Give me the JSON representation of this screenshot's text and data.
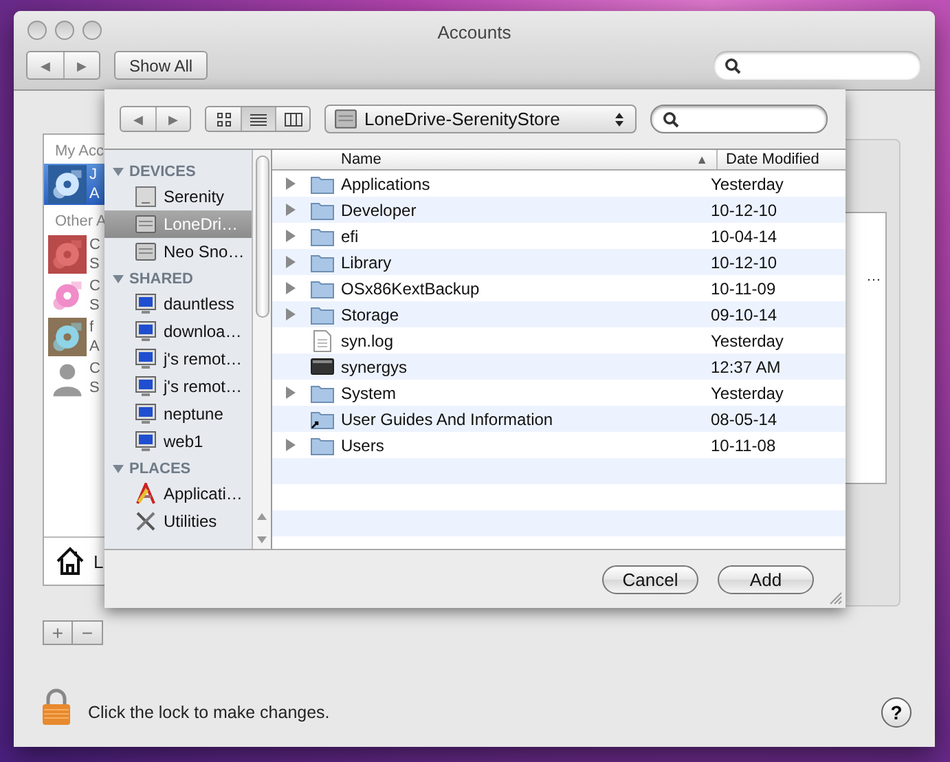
{
  "window": {
    "title": "Accounts"
  },
  "toolbar": {
    "back": "◀",
    "forward": "▶",
    "show_all": "Show All"
  },
  "accounts": {
    "my_header": "My Acc",
    "other_header": "Other A",
    "mine": [
      {
        "line1": "J",
        "line2": "A",
        "kind": "picture",
        "selected": true
      }
    ],
    "others": [
      {
        "line1": "C",
        "line2": "S",
        "kind": "picture",
        "selected": false
      },
      {
        "line1": "C",
        "line2": "S",
        "kind": "picture",
        "selected": false
      },
      {
        "line1": "f",
        "line2": "A",
        "kind": "picture",
        "selected": false
      },
      {
        "line1": "C",
        "line2": "S",
        "kind": "silhouette",
        "selected": false
      }
    ],
    "login_options": "L",
    "add": "+",
    "remove": "−"
  },
  "side_panel": {
    "cut_text": "…"
  },
  "lock_text": "Click the lock to make changes.",
  "help": "?",
  "sheet": {
    "back": "◀",
    "forward": "▶",
    "view_modes": [
      {
        "kind": "icons",
        "selected": false
      },
      {
        "kind": "list",
        "selected": true
      },
      {
        "kind": "columns",
        "selected": false
      }
    ],
    "location": "LoneDrive-SerenityStore",
    "sidebar": [
      {
        "header": "DEVICES",
        "expanded": true,
        "items": [
          {
            "label": "Serenity",
            "kind": "computer",
            "selected": false
          },
          {
            "label": "LoneDri…",
            "kind": "drive",
            "selected": true
          },
          {
            "label": "Neo Sno…",
            "kind": "drive",
            "selected": false
          }
        ]
      },
      {
        "header": "SHARED",
        "expanded": true,
        "items": [
          {
            "label": "dauntless",
            "kind": "monitor",
            "selected": false
          },
          {
            "label": "downloa…",
            "kind": "monitor",
            "selected": false
          },
          {
            "label": "j's remot…",
            "kind": "monitor",
            "selected": false
          },
          {
            "label": "j's remot…",
            "kind": "monitor",
            "selected": false
          },
          {
            "label": "neptune",
            "kind": "monitor",
            "selected": false
          },
          {
            "label": "web1",
            "kind": "monitor",
            "selected": false
          }
        ]
      },
      {
        "header": "PLACES",
        "expanded": true,
        "items": [
          {
            "label": "Applicati…",
            "kind": "applications",
            "selected": false
          },
          {
            "label": "Utilities",
            "kind": "utilities",
            "selected": false
          }
        ]
      }
    ],
    "columns": [
      {
        "label": "Name",
        "sort": "▲"
      },
      {
        "label": "Date Modified"
      }
    ],
    "rows": [
      {
        "name": "Applications",
        "date": "Yesterday",
        "kind": "folder",
        "expandable": true
      },
      {
        "name": "Developer",
        "date": "10-12-10",
        "kind": "folder",
        "expandable": true
      },
      {
        "name": "efi",
        "date": "10-04-14",
        "kind": "folder",
        "expandable": true
      },
      {
        "name": "Library",
        "date": "10-12-10",
        "kind": "folder",
        "expandable": true
      },
      {
        "name": "OSx86KextBackup",
        "date": "10-11-09",
        "kind": "folder",
        "expandable": true
      },
      {
        "name": "Storage",
        "date": "09-10-14",
        "kind": "folder",
        "expandable": true
      },
      {
        "name": "syn.log",
        "date": "Yesterday",
        "kind": "document",
        "expandable": false
      },
      {
        "name": "synergys",
        "date": "12:37 AM",
        "kind": "executable",
        "expandable": false
      },
      {
        "name": "System",
        "date": "Yesterday",
        "kind": "folder",
        "expandable": true
      },
      {
        "name": "User Guides And Information",
        "date": "08-05-14",
        "kind": "alias",
        "expandable": false
      },
      {
        "name": "Users",
        "date": "10-11-08",
        "kind": "folder",
        "expandable": true
      }
    ],
    "buttons": [
      "Cancel",
      "Add"
    ]
  }
}
